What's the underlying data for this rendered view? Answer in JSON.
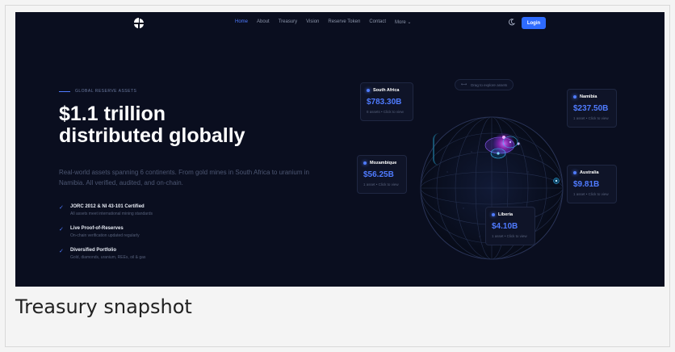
{
  "nav": {
    "links": [
      {
        "label": "Home",
        "active": true
      },
      {
        "label": "About",
        "active": false
      },
      {
        "label": "Treasury",
        "active": false
      },
      {
        "label": "Vision",
        "active": false
      },
      {
        "label": "Reserve Token",
        "active": false
      },
      {
        "label": "Contact",
        "active": false
      },
      {
        "label": "More ⌄",
        "active": false
      }
    ],
    "login_label": "Login"
  },
  "hero": {
    "eyebrow": "GLOBAL RESERVE ASSETS",
    "headline_line1": "$1.1 trillion",
    "headline_line2": "distributed globally",
    "subtext": "Real-world assets spanning 6 continents. From gold mines in South Africa to uranium in Namibia. All verified, audited, and on-chain.",
    "features": [
      {
        "title": "JORC 2012 & NI 43-101 Certified",
        "desc": "All assets meet international mining standards"
      },
      {
        "title": "Live Proof-of-Reserves",
        "desc": "On-chain verification updated regularly"
      },
      {
        "title": "Diversified Portfolio",
        "desc": "Gold, diamonds, uranium, REEs, oil & gas"
      }
    ]
  },
  "globe": {
    "hint": "Drag to explore assets",
    "cards": [
      {
        "name": "South Africa",
        "value": "$783.30B",
        "note": "8 assets • Click to view"
      },
      {
        "name": "Namibia",
        "value": "$237.50B",
        "note": "1 asset • Click to view"
      },
      {
        "name": "Mozambique",
        "value": "$56.25B",
        "note": "1 asset • Click to view"
      },
      {
        "name": "Australia",
        "value": "$9.81B",
        "note": "1 asset • Click to view"
      },
      {
        "name": "Liberia",
        "value": "$4.10B",
        "note": "1 asset • Click to view"
      }
    ]
  },
  "caption": "Treasury snapshot",
  "colors": {
    "accent": "#4f7bff",
    "background": "#0a0e1f",
    "login": "#2e6bff",
    "highlight": "#c026d3"
  }
}
